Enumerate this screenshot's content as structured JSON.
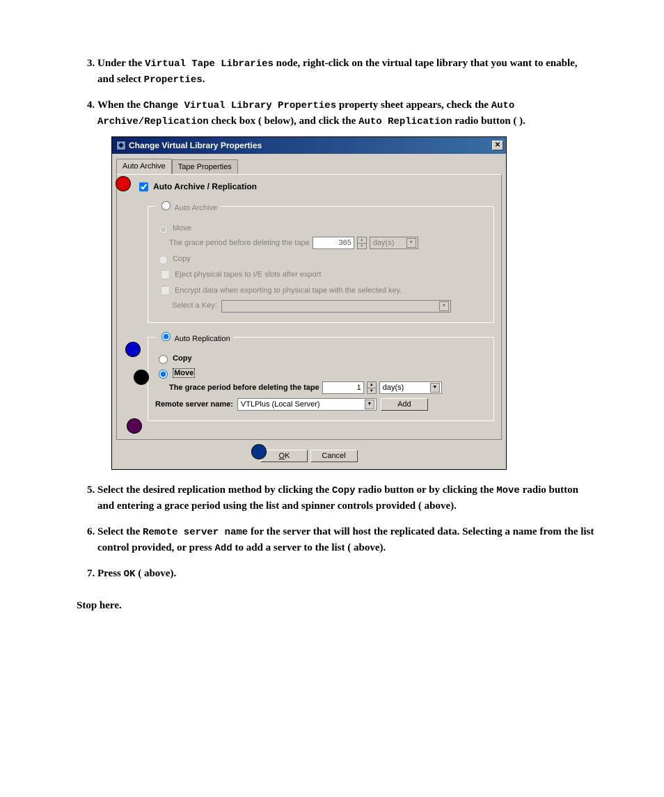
{
  "steps": {
    "s3": {
      "pre": "Under the ",
      "code1": "Virtual Tape Libraries",
      "mid": " node, right-click on the virtual tape library that you want to enable, and select ",
      "code2": "Properties",
      "post": "."
    },
    "s4": {
      "pre": "When the ",
      "code1": "Change Virtual Library Properties",
      "mid1": " property sheet appears, check the ",
      "code2": "Auto Archive/Replication",
      "mid2": " check box (   below), and click the ",
      "code3": "Auto Replication",
      "post": " radio button (  )."
    },
    "s5": {
      "pre": "Select the desired replication method by clicking the ",
      "code1": "Copy",
      "mid1": " radio button or by clicking the ",
      "code2": "Move",
      "post": " radio button and entering a grace period using the list and spinner controls provided (   above)."
    },
    "s6": {
      "pre": "Select the ",
      "code1": "Remote server name",
      "mid1": " for the server that will host the replicated data. Selecting a name from the list control provided, or press ",
      "code2": "Add",
      "post": " to add a server to the list (   above)."
    },
    "s7": {
      "pre": "Press ",
      "code1": "OK",
      "post": " (   above)."
    }
  },
  "stop": "Stop here.",
  "dialog": {
    "title": "Change Virtual Library Properties",
    "tabs": {
      "active": "Auto Archive",
      "inactive": "Tape Properties"
    },
    "main_check": "Auto Archive / Replication",
    "auto_archive": {
      "legend": "Auto Archive",
      "move": "Move",
      "copy": "Copy",
      "grace_label": "The grace period before deleting the tape",
      "grace_value": "365",
      "grace_unit": "day(s)",
      "eject": "Eject physical tapes to I/E slots after export",
      "encrypt": "Encrypt data when exporting to physical tape with the selected key.",
      "keylabel": "Select a Key:"
    },
    "auto_repl": {
      "legend": "Auto Replication",
      "copy": "Copy",
      "move": "Move",
      "grace_label": "The grace period before deleting the tape",
      "grace_value": "1",
      "grace_unit": "day(s)",
      "remote_label": "Remote server name:",
      "remote_value": "VTLPlus (Local Server)",
      "add": "Add"
    },
    "ok": "OK",
    "ok_key": "O",
    "ok_rest": "K",
    "cancel": "Cancel"
  }
}
